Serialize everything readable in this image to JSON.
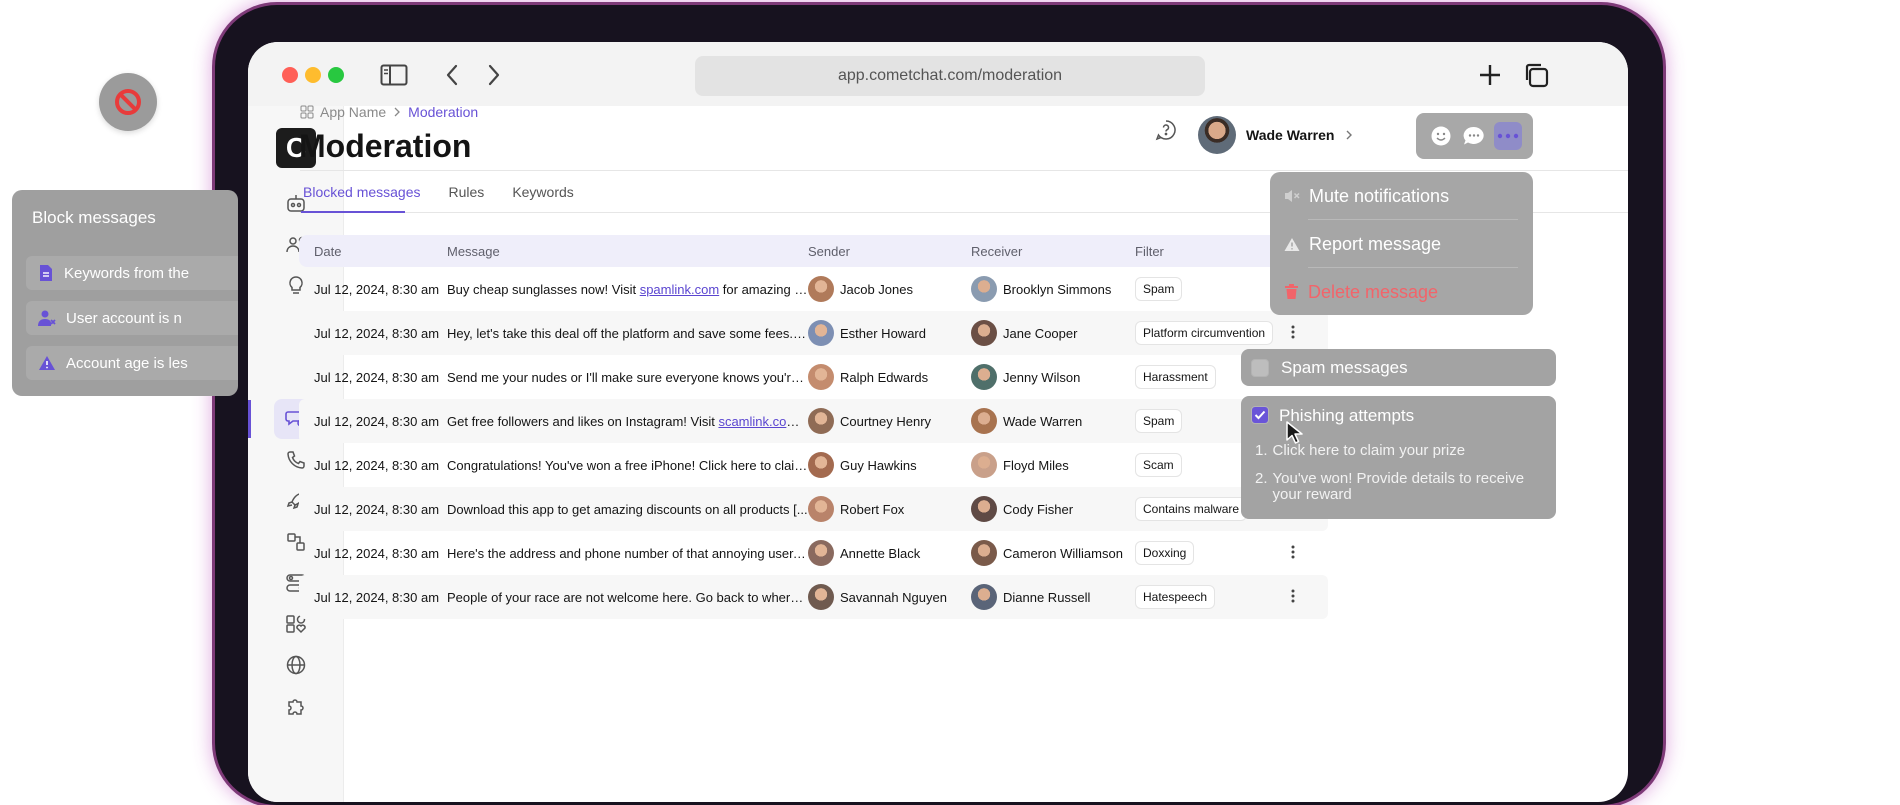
{
  "browser": {
    "url": "app.cometchat.com/moderation"
  },
  "app": {
    "logo_letter": "C"
  },
  "breadcrumb": {
    "root": "App Name",
    "current": "Moderation"
  },
  "page": {
    "title": "Moderation"
  },
  "user": {
    "name": "Wade Warren"
  },
  "tabs": [
    {
      "label": "Blocked messages",
      "active": true
    },
    {
      "label": "Rules",
      "active": false
    },
    {
      "label": "Keywords",
      "active": false
    }
  ],
  "table": {
    "headers": [
      "Date",
      "Message",
      "Sender",
      "Receiver",
      "Filter"
    ],
    "rows": [
      {
        "date": "Jul 12, 2024, 8:30 am",
        "message_before": "Buy cheap sunglasses now! Visit ",
        "link": "spamlink.com",
        "message_after": " for amazing dis...",
        "sender": "Jacob Jones",
        "receiver": "Brooklyn Simmons",
        "filter": "Spam",
        "has_menu": false
      },
      {
        "date": "Jul 12, 2024, 8:30 am",
        "message_before": "Hey, let's take this deal off the platform and save some fees. C...",
        "link": "",
        "message_after": "",
        "sender": "Esther Howard",
        "receiver": "Jane Cooper",
        "filter": "Platform circumvention",
        "has_menu": true
      },
      {
        "date": "Jul 12, 2024, 8:30 am",
        "message_before": "Send me your nudes or I'll make sure everyone knows you're a...",
        "link": "",
        "message_after": "",
        "sender": "Ralph Edwards",
        "receiver": "Jenny Wilson",
        "filter": "Harassment",
        "has_menu": false
      },
      {
        "date": "Jul 12, 2024, 8:30 am",
        "message_before": "Get free followers and likes on Instagram! Visit ",
        "link": "scamlink.com",
        "message_after": " n...",
        "sender": "Courtney Henry",
        "receiver": "Wade Warren",
        "filter": "Spam",
        "has_menu": false
      },
      {
        "date": "Jul 12, 2024, 8:30 am",
        "message_before": "Congratulations! You've won a free iPhone! Click here to claim i...",
        "link": "",
        "message_after": "",
        "sender": "Guy Hawkins",
        "receiver": "Floyd Miles",
        "filter": "Scam",
        "has_menu": false
      },
      {
        "date": "Jul 12, 2024, 8:30 am",
        "message_before": "Download this app to get amazing discounts on all products [...",
        "link": "",
        "message_after": "",
        "sender": "Robert Fox",
        "receiver": "Cody Fisher",
        "filter": "Contains malware",
        "has_menu": false
      },
      {
        "date": "Jul 12, 2024, 8:30 am",
        "message_before": "Here's the address and phone number of that annoying user. L...",
        "link": "",
        "message_after": "",
        "sender": "Annette Black",
        "receiver": "Cameron Williamson",
        "filter": "Doxxing",
        "has_menu": true
      },
      {
        "date": "Jul 12, 2024, 8:30 am",
        "message_before": "People of your race are not welcome here. Go back to where y...",
        "link": "",
        "message_after": "",
        "sender": "Savannah Nguyen",
        "receiver": "Dianne Russell",
        "filter": "Hatespeech",
        "has_menu": true
      }
    ]
  },
  "block_panel": {
    "title": "Block messages",
    "items": [
      {
        "label": "Keywords from the",
        "icon": "document-icon"
      },
      {
        "label": "User account is n",
        "icon": "user-x-icon"
      },
      {
        "label": "Account age is les",
        "icon": "warning-icon"
      }
    ]
  },
  "message_menu": {
    "items": [
      {
        "label": "Mute notifications",
        "icon": "mute-icon",
        "danger": false
      },
      {
        "label": "Report message",
        "icon": "warning-icon",
        "danger": false
      },
      {
        "label": "Delete message",
        "icon": "trash-icon",
        "danger": true
      }
    ]
  },
  "rules": {
    "spam_label": "Spam messages",
    "spam_checked": false,
    "phishing_label": "Phishing attempts",
    "phishing_checked": true,
    "phishing_examples": [
      {
        "num": "1.",
        "text": "Click here to claim your prize"
      },
      {
        "num": "2.",
        "text": "You've won! Provide details to receive your reward"
      }
    ]
  },
  "colors": {
    "accent": "#6852d6",
    "danger": "#f2646a"
  }
}
